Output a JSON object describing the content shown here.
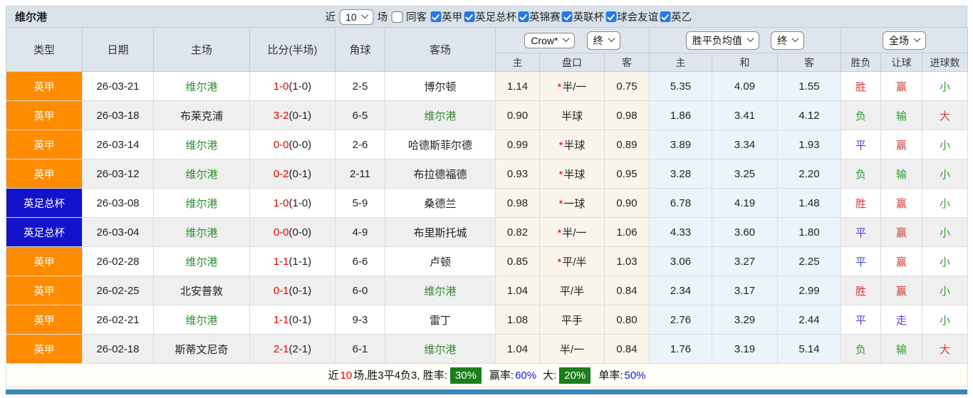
{
  "topbar": {
    "team": "维尔港",
    "recent_label": "近",
    "recent_count": "10",
    "matches_label": "场",
    "same_venue": {
      "label": "同客",
      "checked": false
    },
    "leagues": [
      {
        "label": "英甲",
        "checked": true
      },
      {
        "label": "英足总杯",
        "checked": true
      },
      {
        "label": "英锦赛",
        "checked": true
      },
      {
        "label": "英联杯",
        "checked": true
      },
      {
        "label": "球会友谊",
        "checked": true
      },
      {
        "label": "英乙",
        "checked": true
      }
    ]
  },
  "table": {
    "headers": {
      "type": "类型",
      "date": "日期",
      "home": "主场",
      "score": "比分(半场)",
      "corner": "角球",
      "away": "客场"
    },
    "selects": {
      "odds_company": "Crow*",
      "asia_time": "终",
      "europe_avg": "胜平负均值",
      "europe_time": "终",
      "scope": "全场"
    },
    "sub_headers": [
      "主",
      "盘口",
      "客",
      "主",
      "和",
      "客",
      "胜负",
      "让球",
      "进球数"
    ],
    "rows": [
      {
        "league": "英甲",
        "league_color": "orange",
        "date": "26-03-21",
        "home": "维尔港",
        "home_team": true,
        "score": "1-0",
        "half": "(1-0)",
        "corners": "2-5",
        "away": "博尔顿",
        "away_team": false,
        "asia_home": "1.14",
        "handicap": "半/一",
        "star": true,
        "asia_away": "0.75",
        "eur_home": "5.35",
        "eur_draw": "4.09",
        "eur_away": "1.55",
        "results": [
          {
            "text": "胜",
            "color": "red"
          },
          {
            "text": "赢",
            "color": "red"
          },
          {
            "text": "小",
            "color": "green"
          }
        ]
      },
      {
        "league": "英甲",
        "league_color": "orange",
        "date": "26-03-18",
        "home": "布莱克浦",
        "home_team": false,
        "score": "3-2",
        "half": "(0-1)",
        "corners": "6-5",
        "away": "维尔港",
        "away_team": true,
        "asia_home": "0.90",
        "handicap": "半球",
        "star": false,
        "asia_away": "0.98",
        "eur_home": "1.86",
        "eur_draw": "3.41",
        "eur_away": "4.12",
        "results": [
          {
            "text": "负",
            "color": "green"
          },
          {
            "text": "输",
            "color": "green"
          },
          {
            "text": "大",
            "color": "red"
          }
        ]
      },
      {
        "league": "英甲",
        "league_color": "orange",
        "date": "26-03-14",
        "home": "维尔港",
        "home_team": true,
        "score": "0-0",
        "half": "(0-0)",
        "corners": "2-6",
        "away": "哈德斯菲尔德",
        "away_team": false,
        "asia_home": "0.99",
        "handicap": "半球",
        "star": true,
        "asia_away": "0.89",
        "eur_home": "3.89",
        "eur_draw": "3.34",
        "eur_away": "1.93",
        "results": [
          {
            "text": "平",
            "color": "blue"
          },
          {
            "text": "赢",
            "color": "red"
          },
          {
            "text": "小",
            "color": "green"
          }
        ]
      },
      {
        "league": "英甲",
        "league_color": "orange",
        "date": "26-03-12",
        "home": "维尔港",
        "home_team": true,
        "score": "0-2",
        "half": "(0-1)",
        "corners": "2-11",
        "away": "布拉德福德",
        "away_team": false,
        "asia_home": "0.93",
        "handicap": "半球",
        "star": true,
        "asia_away": "0.95",
        "eur_home": "3.28",
        "eur_draw": "3.25",
        "eur_away": "2.20",
        "results": [
          {
            "text": "负",
            "color": "green"
          },
          {
            "text": "输",
            "color": "green"
          },
          {
            "text": "小",
            "color": "green"
          }
        ]
      },
      {
        "league": "英足总杯",
        "league_color": "blue",
        "date": "26-03-08",
        "home": "维尔港",
        "home_team": true,
        "score": "1-0",
        "half": "(1-0)",
        "corners": "5-9",
        "away": "桑德兰",
        "away_team": false,
        "asia_home": "0.98",
        "handicap": "一球",
        "star": true,
        "asia_away": "0.90",
        "eur_home": "6.78",
        "eur_draw": "4.19",
        "eur_away": "1.48",
        "results": [
          {
            "text": "胜",
            "color": "red"
          },
          {
            "text": "赢",
            "color": "red"
          },
          {
            "text": "小",
            "color": "green"
          }
        ]
      },
      {
        "league": "英足总杯",
        "league_color": "blue",
        "date": "26-03-04",
        "home": "维尔港",
        "home_team": true,
        "score": "0-0",
        "half": "(0-0)",
        "corners": "4-9",
        "away": "布里斯托城",
        "away_team": false,
        "asia_home": "0.82",
        "handicap": "半/一",
        "star": true,
        "asia_away": "1.06",
        "eur_home": "4.33",
        "eur_draw": "3.60",
        "eur_away": "1.80",
        "results": [
          {
            "text": "平",
            "color": "blue"
          },
          {
            "text": "赢",
            "color": "red"
          },
          {
            "text": "小",
            "color": "green"
          }
        ]
      },
      {
        "league": "英甲",
        "league_color": "orange",
        "date": "26-02-28",
        "home": "维尔港",
        "home_team": true,
        "score": "1-1",
        "half": "(1-1)",
        "corners": "6-6",
        "away": "卢顿",
        "away_team": false,
        "asia_home": "0.85",
        "handicap": "平/半",
        "star": true,
        "asia_away": "1.03",
        "eur_home": "3.06",
        "eur_draw": "3.27",
        "eur_away": "2.25",
        "results": [
          {
            "text": "平",
            "color": "blue"
          },
          {
            "text": "赢",
            "color": "red"
          },
          {
            "text": "小",
            "color": "green"
          }
        ]
      },
      {
        "league": "英甲",
        "league_color": "orange",
        "date": "26-02-25",
        "home": "北安普敦",
        "home_team": false,
        "score": "0-1",
        "half": "(0-1)",
        "corners": "6-0",
        "away": "维尔港",
        "away_team": true,
        "asia_home": "1.04",
        "handicap": "平/半",
        "star": false,
        "asia_away": "0.84",
        "eur_home": "2.34",
        "eur_draw": "3.17",
        "eur_away": "2.99",
        "results": [
          {
            "text": "胜",
            "color": "red"
          },
          {
            "text": "赢",
            "color": "red"
          },
          {
            "text": "小",
            "color": "green"
          }
        ]
      },
      {
        "league": "英甲",
        "league_color": "orange",
        "date": "26-02-21",
        "home": "维尔港",
        "home_team": true,
        "score": "1-1",
        "half": "(0-1)",
        "corners": "9-3",
        "away": "雷丁",
        "away_team": false,
        "asia_home": "1.08",
        "handicap": "平手",
        "star": false,
        "asia_away": "0.80",
        "eur_home": "2.76",
        "eur_draw": "3.29",
        "eur_away": "2.44",
        "results": [
          {
            "text": "平",
            "color": "blue"
          },
          {
            "text": "走",
            "color": "blue"
          },
          {
            "text": "小",
            "color": "green"
          }
        ]
      },
      {
        "league": "英甲",
        "league_color": "orange",
        "date": "26-02-18",
        "home": "斯蒂文尼奇",
        "home_team": false,
        "score": "2-1",
        "half": "(2-1)",
        "corners": "6-1",
        "away": "维尔港",
        "away_team": true,
        "asia_home": "1.04",
        "handicap": "半/一",
        "star": false,
        "asia_away": "0.84",
        "eur_home": "1.76",
        "eur_draw": "3.19",
        "eur_away": "5.14",
        "results": [
          {
            "text": "负",
            "color": "green"
          },
          {
            "text": "输",
            "color": "green"
          },
          {
            "text": "大",
            "color": "red"
          }
        ]
      }
    ]
  },
  "summary": {
    "recent_label": "近",
    "recent_count": "10",
    "record_text": "场,胜3平4负3, 胜率:",
    "win_rate": "30%",
    "handicap_label": "赢率:",
    "handicap_rate": "60%",
    "big_label": "大:",
    "big_rate": "20%",
    "odd_label": "单率:",
    "odd_rate": "50%"
  },
  "colors": {
    "league_orange": "#ff8c00",
    "league_blue": "#1313cc",
    "team_green": "#2e8b2e",
    "score_red": "#e80000",
    "result_red": "#d43c3c",
    "result_green": "#2e9e2e",
    "result_blue": "#4646e0",
    "asia_bg": "#faf5ea",
    "europe_bg": "#ebf4fa",
    "badge_green": "#1b7e1b",
    "header_bg": "#dee5ec",
    "topbar_bg": "#dae2e9",
    "bottom_bar_blue": "#3f86b7"
  }
}
